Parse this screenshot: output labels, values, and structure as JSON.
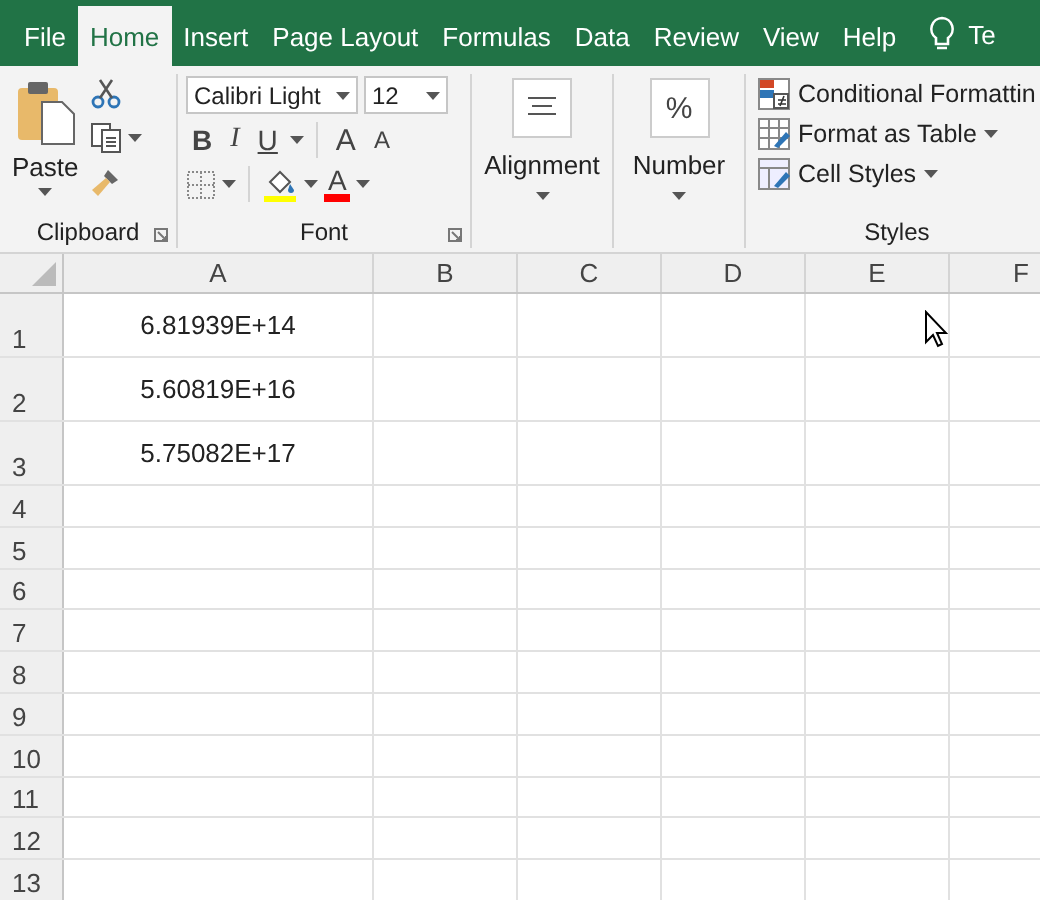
{
  "tabs": [
    {
      "label": "File",
      "selected": false
    },
    {
      "label": "Home",
      "selected": true
    },
    {
      "label": "Insert",
      "selected": false
    },
    {
      "label": "Page Layout",
      "selected": false
    },
    {
      "label": "Formulas",
      "selected": false
    },
    {
      "label": "Data",
      "selected": false
    },
    {
      "label": "Review",
      "selected": false
    },
    {
      "label": "View",
      "selected": false
    },
    {
      "label": "Help",
      "selected": false
    }
  ],
  "tell_me": {
    "text": "Te"
  },
  "clipboard": {
    "paste_label": "Paste",
    "group_label": "Clipboard"
  },
  "font": {
    "font_name": "Calibri Light",
    "font_size": "12",
    "bold": "B",
    "italic": "I",
    "underline": "U",
    "grow": "A",
    "shrink": "A",
    "font_color": "A",
    "group_label": "Font"
  },
  "alignment": {
    "label": "Alignment"
  },
  "number": {
    "symbol": "%",
    "label": "Number"
  },
  "styles": {
    "items": [
      {
        "label": "Conditional Formattin",
        "kind": "conditional",
        "caret": false
      },
      {
        "label": "Format as Table",
        "kind": "table",
        "caret": true
      },
      {
        "label": "Cell Styles",
        "kind": "cellstyles",
        "caret": true
      }
    ],
    "group_label": "Styles"
  },
  "sheet": {
    "columns": [
      "A",
      "B",
      "C",
      "D",
      "E",
      "F"
    ],
    "rows": [
      {
        "number": "1",
        "cells": [
          "6.81939E+14"
        ]
      },
      {
        "number": "2",
        "cells": [
          "5.60819E+16"
        ]
      },
      {
        "number": "3",
        "cells": [
          "5.75082E+17"
        ]
      },
      {
        "number": "4"
      },
      {
        "number": "5"
      },
      {
        "number": "6"
      },
      {
        "number": "7"
      },
      {
        "number": "8"
      },
      {
        "number": "9"
      },
      {
        "number": "10"
      },
      {
        "number": "11"
      },
      {
        "number": "12"
      },
      {
        "number": "13"
      }
    ]
  }
}
